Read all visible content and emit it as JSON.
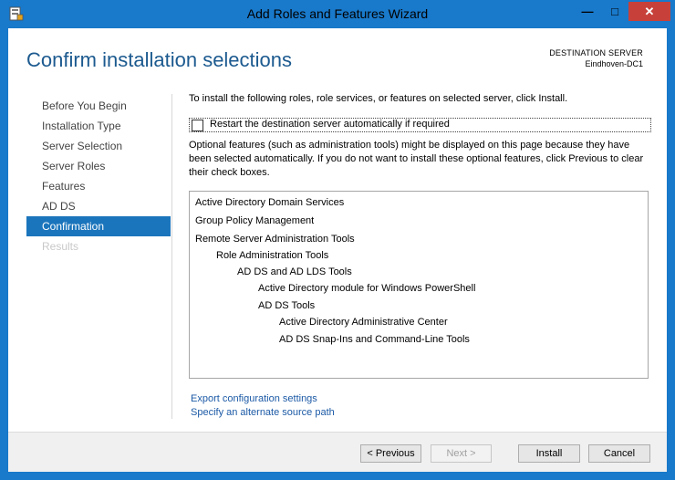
{
  "window": {
    "title": "Add Roles and Features Wizard",
    "caption_buttons": [
      "—",
      "□",
      "✕"
    ]
  },
  "header": {
    "title": "Confirm installation selections",
    "destination_label": "DESTINATION SERVER",
    "destination_name": "Eindhoven-DC1"
  },
  "nav": {
    "items": [
      {
        "label": "Before You Begin",
        "state": "normal"
      },
      {
        "label": "Installation Type",
        "state": "normal"
      },
      {
        "label": "Server Selection",
        "state": "normal"
      },
      {
        "label": "Server Roles",
        "state": "normal"
      },
      {
        "label": "Features",
        "state": "normal"
      },
      {
        "label": "AD DS",
        "state": "normal"
      },
      {
        "label": "Confirmation",
        "state": "active"
      },
      {
        "label": "Results",
        "state": "disabled"
      }
    ]
  },
  "main": {
    "intro": "To install the following roles, role services, or features on selected server, click Install.",
    "restart_label": "Restart the destination server automatically if required",
    "restart_checked": false,
    "optional_text": "Optional features (such as administration tools) might be displayed on this page because they have been selected automatically. If you do not want to install these optional features, click Previous to clear their check boxes.",
    "selections": [
      {
        "label": "Active Directory Domain Services",
        "level": 0
      },
      {
        "label": "Group Policy Management",
        "level": 0
      },
      {
        "label": "Remote Server Administration Tools",
        "level": 0
      },
      {
        "label": "Role Administration Tools",
        "level": 1
      },
      {
        "label": "AD DS and AD LDS Tools",
        "level": 2
      },
      {
        "label": "Active Directory module for Windows PowerShell",
        "level": 3
      },
      {
        "label": "AD DS Tools",
        "level": 3
      },
      {
        "label": "Active Directory Administrative Center",
        "level": 4
      },
      {
        "label": "AD DS Snap-Ins and Command-Line Tools",
        "level": 4
      }
    ],
    "export_link": "Export configuration settings",
    "source_link": "Specify an alternate source path"
  },
  "footer": {
    "previous": "< Previous",
    "next": "Next >",
    "install": "Install",
    "cancel": "Cancel"
  },
  "colors": {
    "titlebar": "#1979ca",
    "accent": "#1b75bc",
    "close": "#c7413a",
    "link": "#1c5aa6"
  }
}
